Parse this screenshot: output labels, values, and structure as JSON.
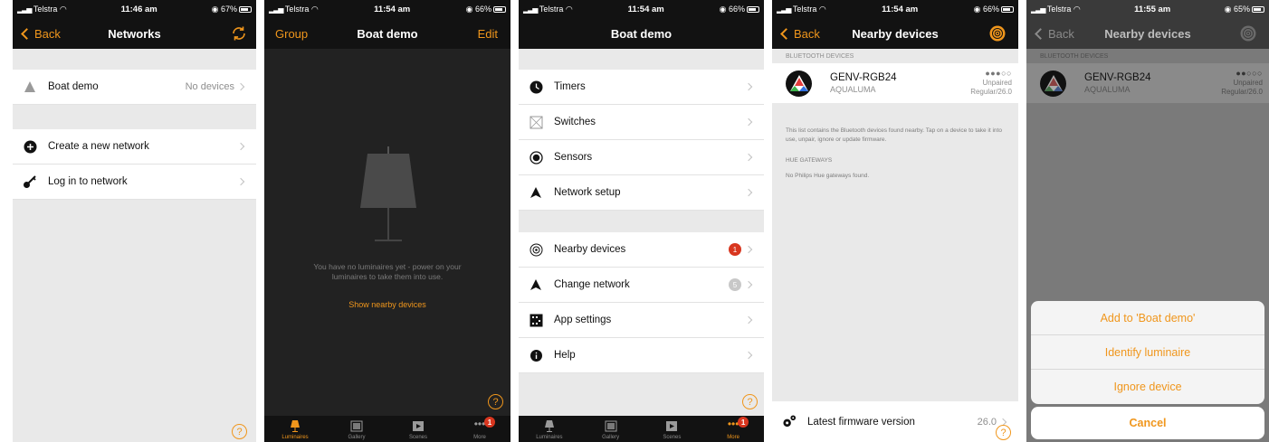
{
  "status": {
    "p1": {
      "carrier": "Telstra",
      "time": "11:46 am",
      "battery": "67%"
    },
    "p2": {
      "carrier": "Telstra",
      "time": "11:54 am",
      "battery": "66%"
    },
    "p3": {
      "carrier": "Telstra",
      "time": "11:54 am",
      "battery": "66%"
    },
    "p4": {
      "carrier": "Telstra",
      "time": "11:54 am",
      "battery": "66%"
    },
    "p5": {
      "carrier": "Telstra",
      "time": "11:55 am",
      "battery": "65%"
    }
  },
  "screen1": {
    "back_label": "Back",
    "title": "Networks",
    "network_name": "Boat demo",
    "network_status": "No devices",
    "create_network": "Create a new network",
    "login_network": "Log in to network",
    "help": "?"
  },
  "screen2": {
    "left_label": "Group",
    "title": "Boat demo",
    "right_label": "Edit",
    "empty_message": "You have no luminaires yet - power on your luminaires to take them into use.",
    "show_nearby": "Show nearby devices",
    "help": "?",
    "tabs": [
      "Luminaires",
      "Gallery",
      "Scenes",
      "More"
    ],
    "more_badge": "1"
  },
  "screen3": {
    "title": "Boat demo",
    "items": [
      "Timers",
      "Switches",
      "Sensors",
      "Network setup"
    ],
    "items2": [
      "Nearby devices",
      "Change network",
      "App settings",
      "Help"
    ],
    "nearby_badge": "1",
    "change_badge": "5",
    "help": "?",
    "tabs": [
      "Luminaires",
      "Gallery",
      "Scenes",
      "More"
    ],
    "more_badge": "1"
  },
  "screen4": {
    "back_label": "Back",
    "title": "Nearby devices",
    "section_bt": "BLUETOOTH DEVICES",
    "device_name": "GENV-RGB24",
    "device_brand": "AQUALUMA",
    "device_signal": "●●●○○",
    "device_state": "Unpaired",
    "device_version": "Regular/26.0",
    "info_text": "This list contains the Bluetooth devices found nearby. Tap on a device to take it into use, unpair, ignore or update firmware.",
    "section_hue": "HUE GATEWAYS",
    "hue_text": "No Philips Hue gateways found.",
    "firmware_label": "Latest firmware version",
    "firmware_value": "26.0",
    "help": "?"
  },
  "screen5": {
    "back_label": "Back",
    "title": "Nearby devices",
    "section_bt": "BLUETOOTH DEVICES",
    "device_name": "GENV-RGB24",
    "device_brand": "AQUALUMA",
    "device_signal": "●●○○○",
    "device_state": "Unpaired",
    "device_version": "Regular/26.0",
    "actions": [
      "Add to 'Boat demo'",
      "Identify luminaire",
      "Ignore device"
    ],
    "cancel": "Cancel"
  },
  "colors": {
    "accent": "#f0961c",
    "badge": "#d8361f",
    "bar": "#121212",
    "background": "#e9e9e9"
  }
}
